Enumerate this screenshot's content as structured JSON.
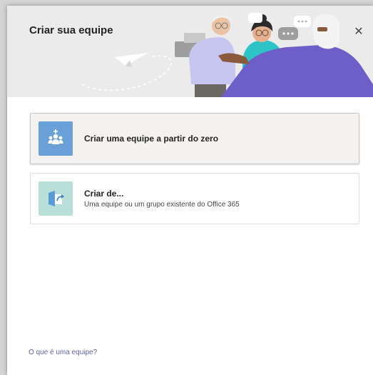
{
  "dialog": {
    "title": "Criar sua equipe",
    "close_glyph": "✕"
  },
  "options": [
    {
      "icon": "people-plus-icon",
      "title": "Criar uma equipe a partir do zero",
      "subtitle": "",
      "selected": true
    },
    {
      "icon": "door-arrow-icon",
      "title": "Criar de...",
      "subtitle": "Uma equipe ou um grupo existente do Office 365",
      "selected": false
    }
  ],
  "footer": {
    "help_link": "O que é uma equipe?"
  },
  "colors": {
    "header_bg": "#ebebeb",
    "accent": "#6264a7",
    "option1_icon_bg": "#6aa0d8",
    "option2_icon_bg": "#b8e0d8"
  }
}
